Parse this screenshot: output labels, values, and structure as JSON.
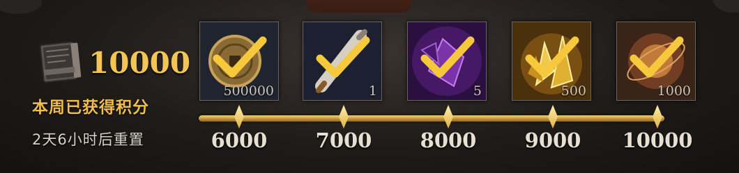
{
  "summary": {
    "total_points": "10000",
    "weekly_label": "本周已获得积分",
    "reset_text": "2天6小时后重置"
  },
  "rewards": [
    {
      "item_icon": "gold-coin-icon",
      "quantity": "500000",
      "threshold": "6000",
      "claimed": true,
      "bg": "#20242e"
    },
    {
      "item_icon": "scroll-icon",
      "quantity": "1",
      "threshold": "7000",
      "claimed": true,
      "bg": "#1c2030"
    },
    {
      "item_icon": "purple-crystal-icon",
      "quantity": "5",
      "threshold": "8000",
      "claimed": true,
      "bg": "#3a1450"
    },
    {
      "item_icon": "gold-crystal-icon",
      "quantity": "500",
      "threshold": "9000",
      "claimed": true,
      "bg": "#5a3a10"
    },
    {
      "item_icon": "orb-icon",
      "quantity": "1000",
      "threshold": "10000",
      "claimed": true,
      "bg": "#4a2a18"
    }
  ],
  "colors": {
    "gold": "#f3c552",
    "track": "#d8ab4a"
  }
}
